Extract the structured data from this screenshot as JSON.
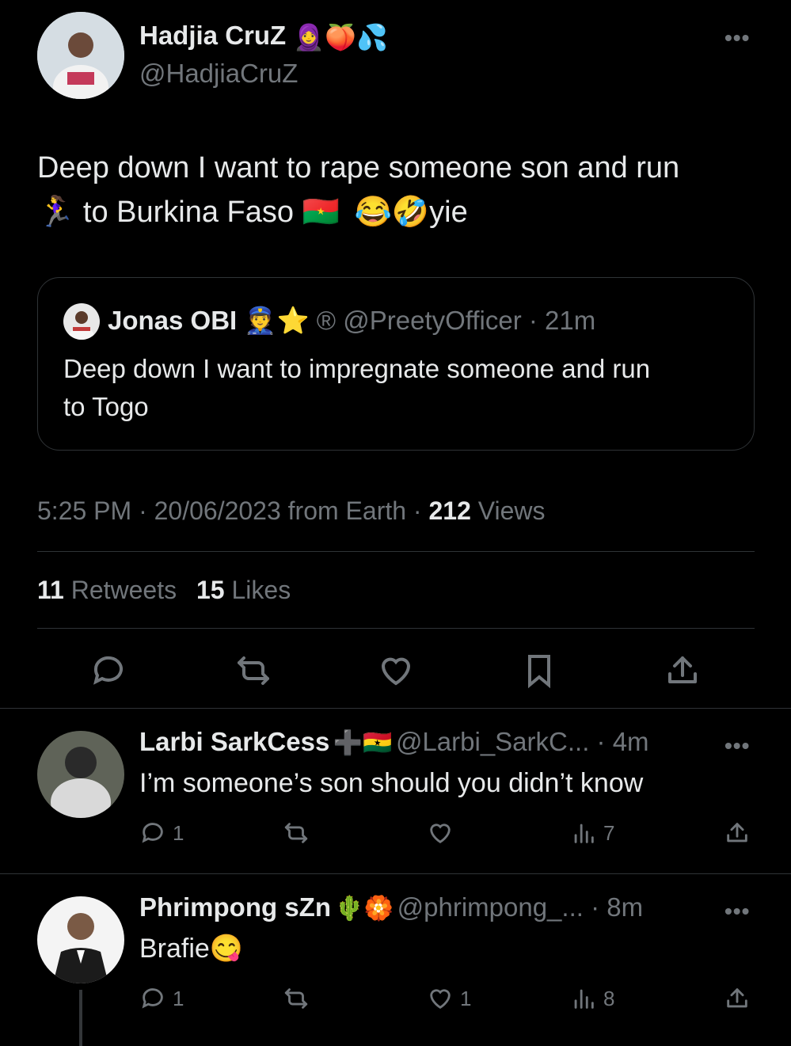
{
  "main_tweet": {
    "author_name": "Hadjia CruZ",
    "author_emojis": "🧕🍑💦",
    "handle": "@HadjiaCruZ",
    "more": "•••",
    "text_line1": "Deep down I want to rape someone son and run",
    "text_line2_emoji": "🏃‍♀️",
    "text_line2": "to Burkina Faso",
    "text_line2_flag": "🇧🇫",
    "text_line2_tail_emojis": "😂🤣",
    "text_line2_tail": "yie",
    "timestamp": "5:25 PM · 20/06/2023 from Earth · ",
    "views_count": "212",
    "views_label": " Views",
    "retweets_count": "11",
    "retweets_label": " Retweets",
    "likes_count": "15",
    "likes_label": " Likes"
  },
  "quoted_tweet": {
    "author_name": "Jonas OBI",
    "author_emojis": "👮⭐",
    "registered_mark": "®",
    "handle": "@PreetyOfficer",
    "time": " · 21m",
    "text_line1": "Deep down I want to impregnate someone and run",
    "text_line2": "to Togo"
  },
  "replies": [
    {
      "author_name": "Larbi SarkCess",
      "author_emojis": "➕🇬🇭",
      "handle": "@Larbi_SarkC...",
      "time": " · 4m",
      "more": "•••",
      "text": "I’m someone’s son should you didn’t know",
      "reply_count": "1",
      "retweet_count": "",
      "like_count": "",
      "views_count": "7"
    },
    {
      "author_name": "Phrimpong sZn",
      "author_emojis": "🌵🏵️",
      "handle": "@phrimpong_...",
      "time": " · 8m",
      "more": "•••",
      "text": "Brafie",
      "text_emoji": "😋",
      "reply_count": "1",
      "retweet_count": "",
      "like_count": "1",
      "views_count": "8"
    }
  ],
  "colors": {
    "background": "#000000",
    "text": "#e7e9ea",
    "muted": "#71767b",
    "border": "#2f3336"
  }
}
